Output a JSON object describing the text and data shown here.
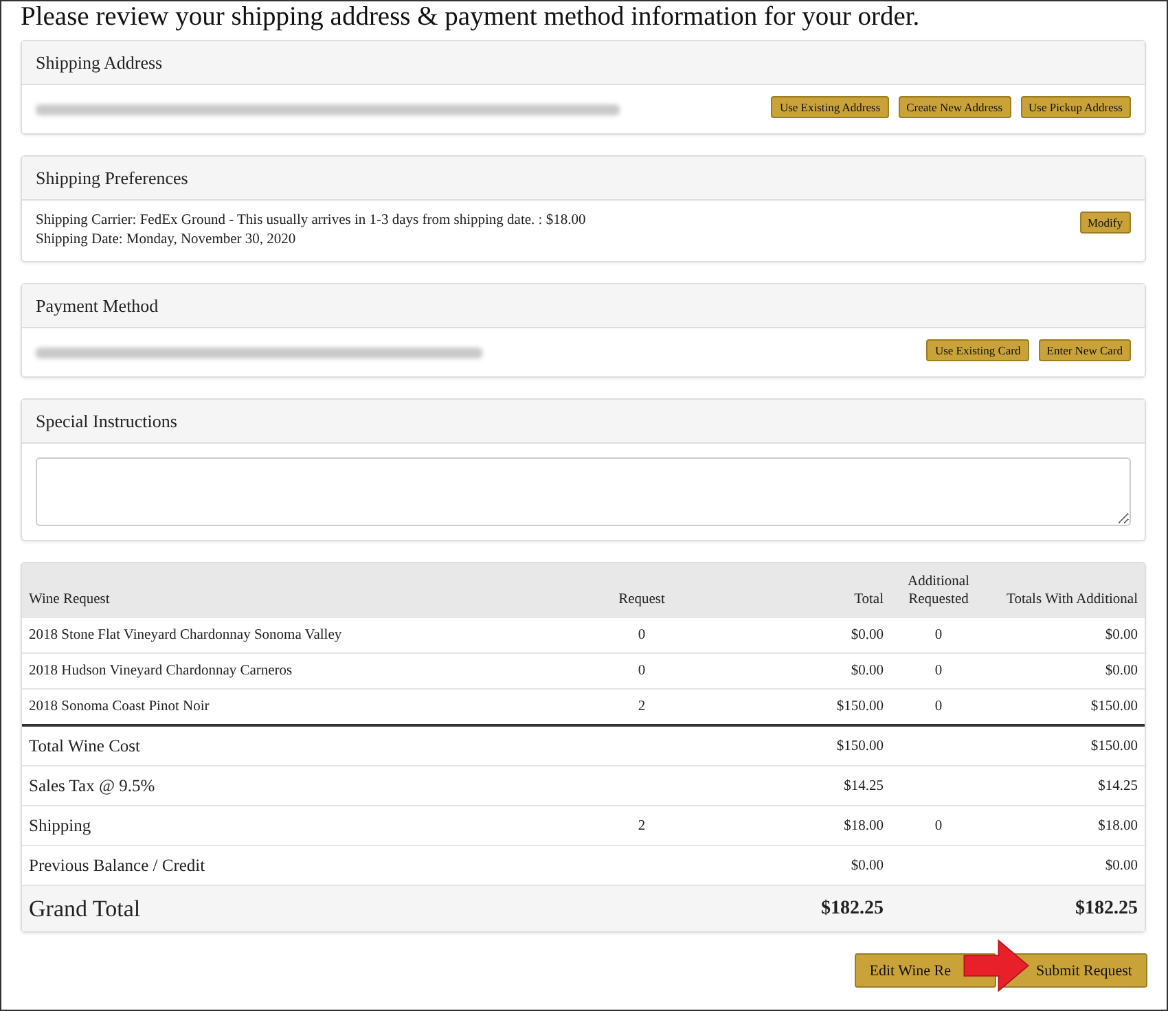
{
  "heading": "Please review your shipping address & payment method information for your order.",
  "sections": [
    {
      "kind": "redacted",
      "title": "Shipping Address",
      "buttons": [
        "Use Existing Address",
        "Create New Address",
        "Use Pickup Address"
      ]
    },
    {
      "kind": "text",
      "title": "Shipping Preferences",
      "lines": [
        "Shipping Carrier: FedEx Ground - This usually arrives in 1-3 days from shipping date. : $18.00",
        "Shipping Date: Monday, November 30, 2020"
      ],
      "buttons": [
        "Modify"
      ]
    },
    {
      "kind": "redacted",
      "title": "Payment Method",
      "buttons": [
        "Use Existing Card",
        "Enter New Card"
      ]
    },
    {
      "kind": "textarea",
      "title": "Special Instructions"
    }
  ],
  "table": {
    "columns": [
      "Wine Request",
      "Request",
      "Total",
      "Additional Requested",
      "Totals With Additional"
    ],
    "rows": [
      {
        "cells": [
          "2018 Stone Flat Vineyard Chardonnay Sonoma Valley",
          "0",
          "$0.00",
          "0",
          "$0.00"
        ]
      },
      {
        "cells": [
          "2018 Hudson Vineyard Chardonnay Carneros",
          "0",
          "$0.00",
          "0",
          "$0.00"
        ]
      },
      {
        "cells": [
          "2018 Sonoma Coast Pinot Noir",
          "2",
          "$150.00",
          "0",
          "$150.00"
        ]
      }
    ],
    "summary": [
      {
        "kind": "subtotal",
        "cells": [
          "Total Wine Cost",
          "",
          "$150.00",
          "",
          "$150.00"
        ]
      },
      {
        "kind": "line",
        "cells": [
          "Sales Tax @ 9.5%",
          "",
          "$14.25",
          "",
          "$14.25"
        ]
      },
      {
        "kind": "line",
        "cells": [
          "Shipping",
          "2",
          "$18.00",
          "0",
          "$18.00"
        ]
      },
      {
        "kind": "line",
        "cells": [
          "Previous Balance / Credit",
          "",
          "$0.00",
          "",
          "$0.00"
        ]
      },
      {
        "kind": "grand",
        "cells": [
          "Grand Total",
          "",
          "$182.25",
          "",
          "$182.25"
        ]
      }
    ]
  },
  "footer_buttons": [
    "Edit Wine Re",
    "Submit Request"
  ]
}
